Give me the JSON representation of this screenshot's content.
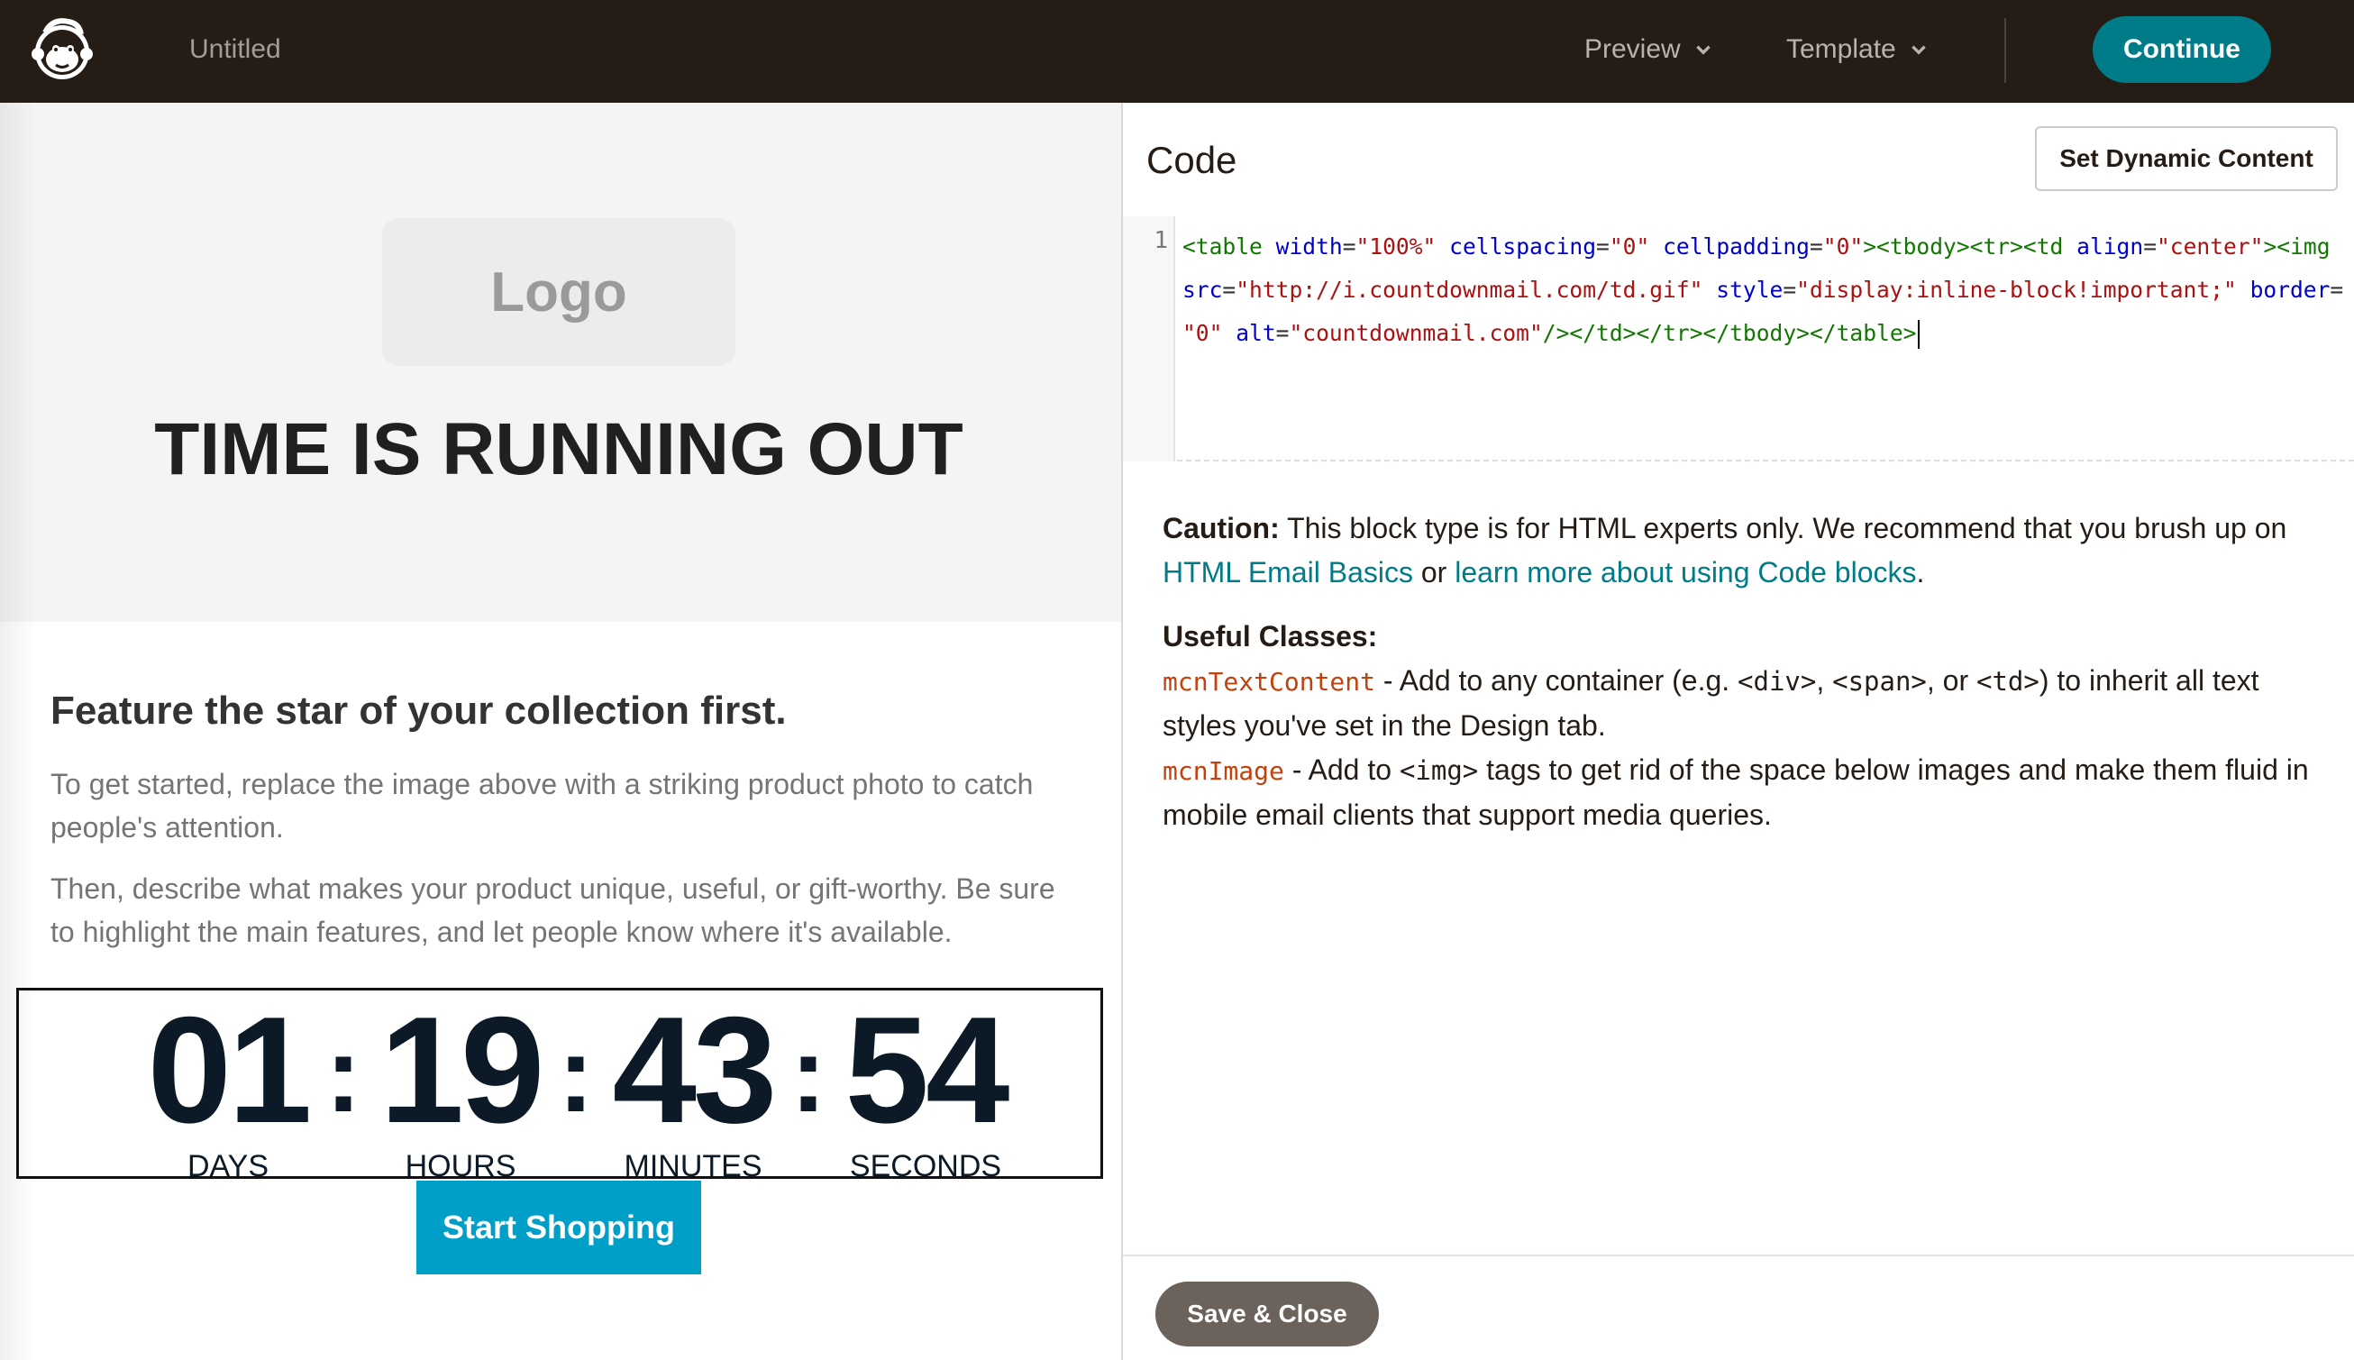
{
  "topbar": {
    "doc_title": "Untitled",
    "preview_label": "Preview",
    "template_label": "Template",
    "continue_label": "Continue",
    "brand_color": "#241c15",
    "accent_color": "#007c89"
  },
  "preview": {
    "logo_placeholder": "Logo",
    "hero_heading": "TIME IS RUNNING OUT",
    "feature_heading": "Feature the star of your collection first.",
    "paragraph_1": "To get started, replace the image above with a striking product photo to catch people's attention.",
    "paragraph_2": "Then, describe what makes your product unique, useful, or gift-worthy. Be sure to highlight the main features, and let people know where it's available.",
    "countdown": {
      "days": "01",
      "hours": "19",
      "minutes": "43",
      "seconds": "54",
      "days_label": "DAYS",
      "hours_label": "HOURS",
      "minutes_label": "MINUTES",
      "seconds_label": "SECONDS",
      "separator": ":"
    },
    "cta_label": "Start Shopping",
    "cta_color": "#009fc8"
  },
  "panel": {
    "title": "Code",
    "dynamic_button": "Set Dynamic Content",
    "line_number": "1",
    "code_text": "<table width=\"100%\" cellspacing=\"0\" cellpadding=\"0\"><tbody><tr><td align=\"center\"><img src=\"http://i.countdownmail.com/td.gif\" style=\"display:inline-block!important;\" border=\"0\" alt=\"countdownmail.com\"/></td></tr></tbody></table>",
    "caution_label": "Caution:",
    "caution_text": "This block type is for HTML experts only. We recommend that you brush up on",
    "link_1": "HTML Email Basics",
    "or_text": "or",
    "link_2": "learn more about using Code blocks",
    "period": ".",
    "classes_heading": "Useful Classes:",
    "class_1_name": "mcnTextContent",
    "class_1_desc_a": "- Add to any container (e.g.",
    "class_1_code_a": "<div>",
    "class_1_comma_a": ",",
    "class_1_code_b": "<span>",
    "class_1_or": ", or",
    "class_1_code_c": "<td>",
    "class_1_desc_b": ") to inherit all text styles you've set in the Design tab.",
    "class_2_name": "mcnImage",
    "class_2_desc_a": "- Add to",
    "class_2_code": "<img>",
    "class_2_desc_b": "tags to get rid of the space below images and make them fluid in mobile email clients that support media queries.",
    "save_label": "Save & Close"
  }
}
